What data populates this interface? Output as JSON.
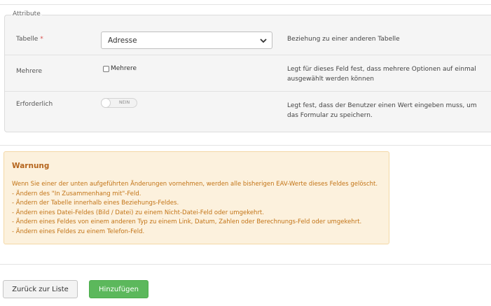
{
  "fieldset": {
    "legend": "Attribute"
  },
  "rows": [
    {
      "label": "Tabelle",
      "required_mark": "*",
      "select_value": "Adresse",
      "help": "Beziehung zu einer anderen Tabelle"
    },
    {
      "label": "Mehrere",
      "checkbox_label": "Mehrere",
      "checked": false,
      "help": "Legt für dieses Feld fest, dass mehrere Optionen auf einmal ausgewählt werden können"
    },
    {
      "label": "Erforderlich",
      "toggle_text": "NEIN",
      "help": "Legt fest, dass der Benutzer einen Wert eingeben muss, um das Formular zu speichern."
    }
  ],
  "warning": {
    "title": "Warnung",
    "lines": [
      "Wenn Sie einer der unten aufgeführten Änderungen vornehmen, werden alle bisherigen EAV-Werte dieses Feldes gelöscht.",
      "- Ändern des \"In Zusammenhang mit\"-Feld.",
      "- Ändern der Tabelle innerhalb eines Beziehungs-Feldes.",
      "- Ändern eines Datei-Feldes (Bild / Datei) zu einem Nicht-Datei-Feld oder umgekehrt.",
      "- Ändern eines Feldes von einem anderen Typ zu einem Link, Datum, Zahlen oder Berechnungs-Feld oder umgekehrt.",
      "- Ändern eines Feldes zu einem Telefon-Feld."
    ]
  },
  "buttons": {
    "back": "Zurück zur Liste",
    "add": "Hinzufügen"
  },
  "colors": {
    "add_button": "#5cb85c",
    "warning_bg": "#fcf1dd",
    "warning_text": "#c77716",
    "required": "#d9534f"
  }
}
